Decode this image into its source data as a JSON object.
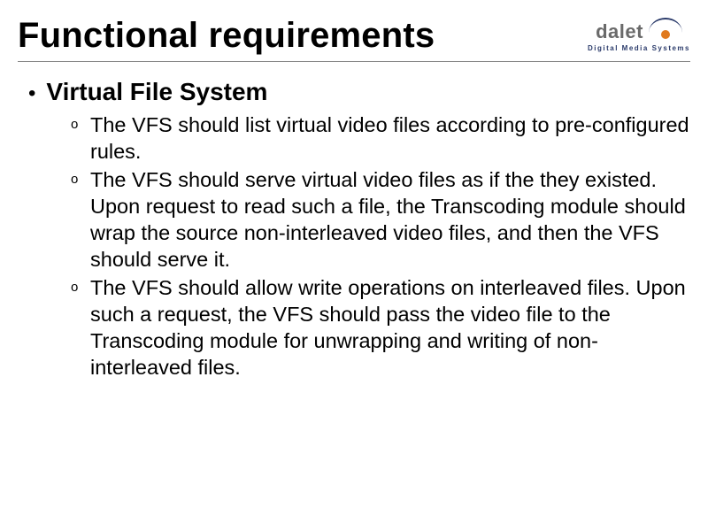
{
  "header": {
    "title": "Functional requirements",
    "logo_word": "dalet",
    "logo_subtext": "Digital Media Systems"
  },
  "content": {
    "main_bullet": "Virtual File System",
    "sub_bullets": [
      "The VFS should list virtual video files according to pre-configured rules.",
      "The VFS should serve virtual video files as if the they existed. Upon request to read such a file, the Transcoding module should wrap the source non-interleaved video files, and then the VFS should serve it.",
      "The VFS should allow write operations on interleaved files. Upon such a request, the VFS should pass the video file to the Transcoding module for unwrapping and writing of non-interleaved files."
    ],
    "sub_marker": "o"
  }
}
